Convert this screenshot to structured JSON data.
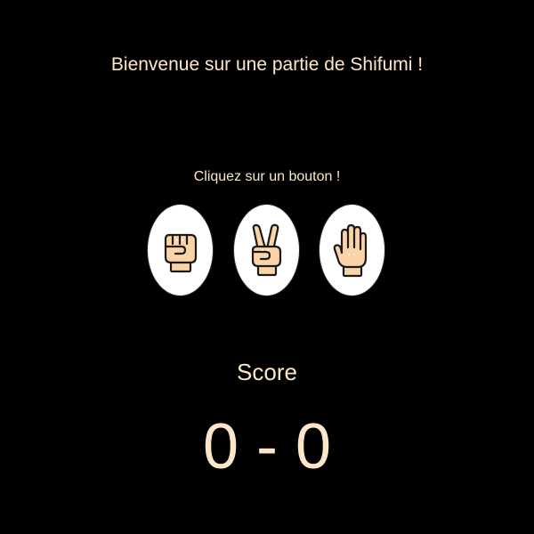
{
  "header": {
    "title": "Bienvenue sur une partie de Shifumi !"
  },
  "game": {
    "instruction": "Cliquez sur un bouton !",
    "choices": [
      {
        "icon": "rock-fist-icon"
      },
      {
        "icon": "scissors-hand-icon"
      },
      {
        "icon": "paper-hand-icon"
      }
    ]
  },
  "score": {
    "label": "Score",
    "value": "0 - 0"
  },
  "colors": {
    "background": "#000000",
    "text": "#fde6c8",
    "skin": "#fbd3a6",
    "outline": "#1a1a1a",
    "button": "#ffffff"
  }
}
